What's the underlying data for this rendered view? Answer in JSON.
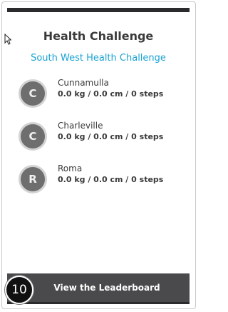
{
  "card": {
    "title": "Health Challenge",
    "subtitle": "South West Health Challenge"
  },
  "entries": [
    {
      "initial": "C",
      "name": "Cunnamulla",
      "stats": "0.0 kg / 0.0 cm / 0 steps"
    },
    {
      "initial": "C",
      "name": "Charleville",
      "stats": "0.0 kg / 0.0 cm / 0 steps"
    },
    {
      "initial": "R",
      "name": "Roma",
      "stats": "0.0 kg / 0.0 cm / 0 steps"
    }
  ],
  "footer": {
    "button_label": "View the Leaderboard"
  },
  "annotation": {
    "step_number": "10"
  },
  "colors": {
    "accent": "#1aa3d4",
    "dark_bar": "#2b2b2d",
    "button_bg": "#4a4a4d",
    "avatar_bg": "#6e6e6e"
  }
}
